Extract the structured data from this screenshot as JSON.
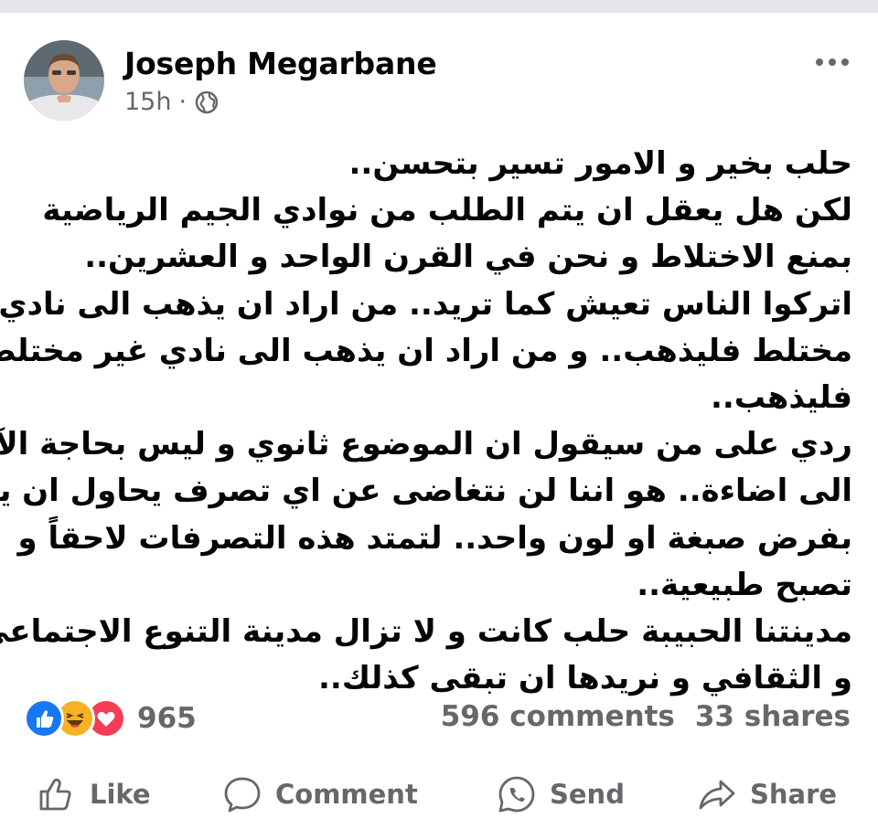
{
  "post": {
    "author": "Joseph Megarbane",
    "time": "15h",
    "separator": "·",
    "privacy_icon": "globe-icon",
    "more_icon": "more-options-icon",
    "text_lines": [
      "حلب بخير و الامور تسير بتحسن..",
      "لكن هل يعقل ان يتم الطلب من نوادي الجيم الرياضية",
      "بمنع الاختلاط و نحن في القرن الواحد و العشرين..",
      "اتركوا الناس تعيش كما تريد.. من اراد ان يذهب الى نادي",
      "مختلط فليذهب.. و من اراد ان يذهب الى نادي غير مختلط",
      "فليذهب..",
      "ردي على من سيقول ان الموضوع ثانوي و ليس بحاجة الآن",
      "الى اضاءة.. هو اننا لن نتغاضى عن اي تصرف يحاول ان يبدأ",
      "بفرض صبغة او لون واحد.. لتمتد هذه التصرفات لاحقاً و",
      "تصبح طبيعية..",
      "مدينتنا الحبيبة حلب كانت و لا تزال مدينة التنوع الاجتماعي",
      "و الثقافي و نريدها ان تبقى كذلك.."
    ]
  },
  "stats": {
    "reaction_icons": [
      "like-reaction-icon",
      "haha-reaction-icon",
      "love-reaction-icon"
    ],
    "reaction_count": "965",
    "comments": "596 comments",
    "shares": "33 shares"
  },
  "actions": {
    "like": "Like",
    "comment": "Comment",
    "send": "Send",
    "share": "Share"
  },
  "colors": {
    "text": "#050505",
    "secondary": "#65676b",
    "like_blue": "#1877f2",
    "love_red": "#f33e58",
    "haha_yellow": "#f7b125",
    "top_bar": "#e4e6eb"
  }
}
